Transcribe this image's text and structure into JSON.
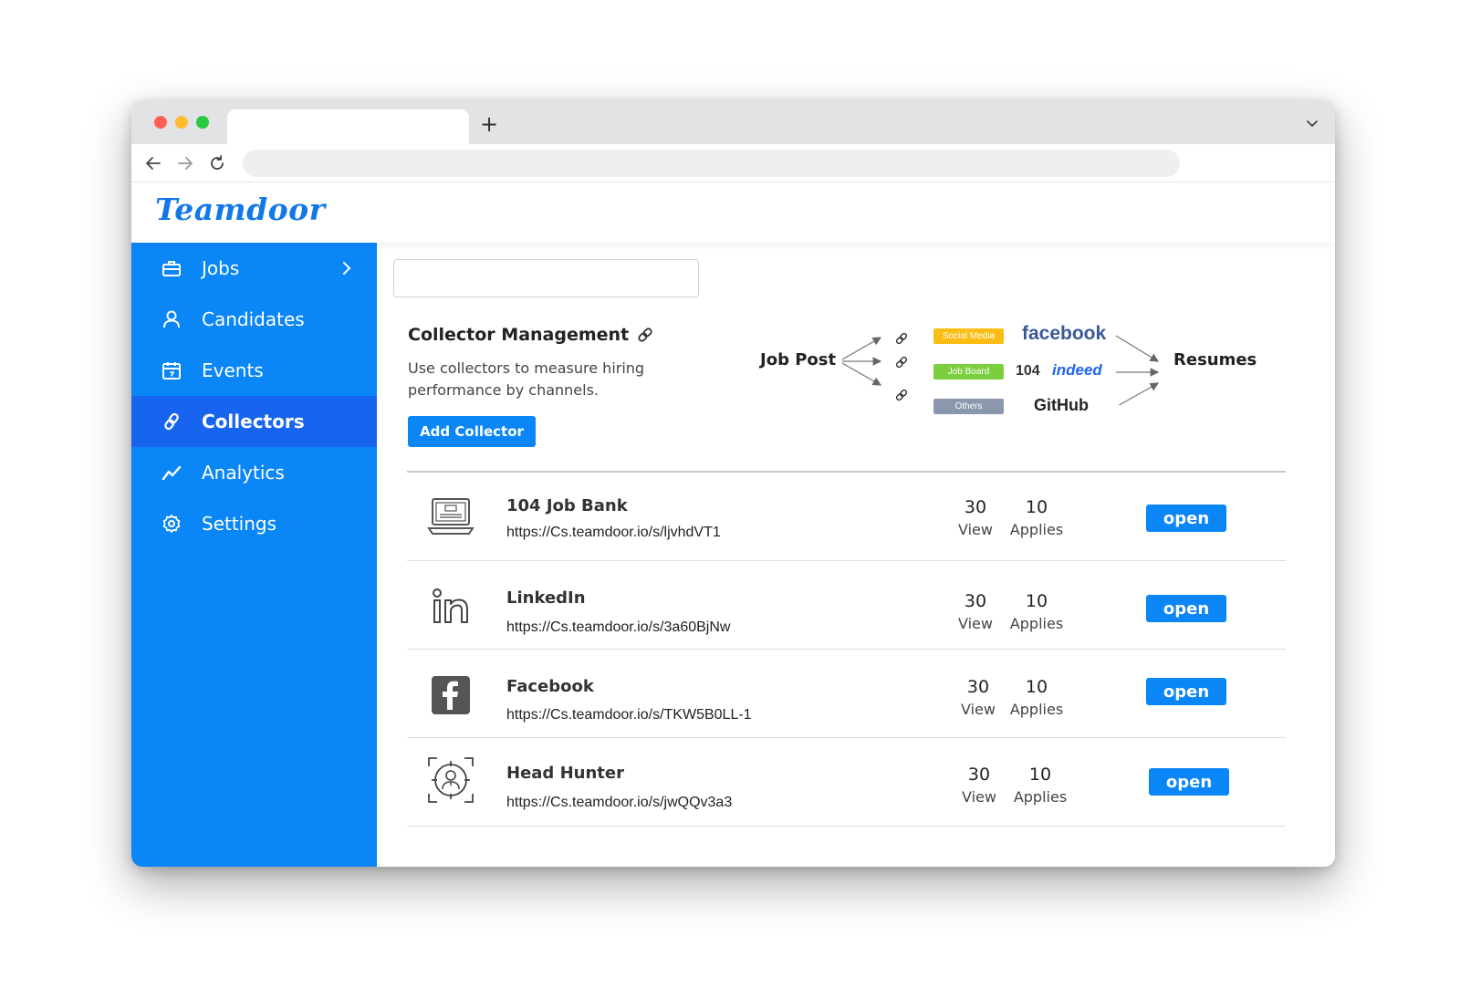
{
  "browser": {
    "new_tab": "+"
  },
  "app": {
    "logo": "Teamdoor"
  },
  "sidebar": {
    "items": [
      {
        "label": "Jobs"
      },
      {
        "label": "Candidates"
      },
      {
        "label": "Events"
      },
      {
        "label": "Collectors"
      },
      {
        "label": "Analytics"
      },
      {
        "label": "Settings"
      }
    ]
  },
  "main": {
    "search": {
      "value": "",
      "placeholder": ""
    },
    "title": "Collector Management",
    "description": "Use collectors to measure hiring performance by channels.",
    "add_button": "Add Collector",
    "diagram": {
      "source": "Job Post",
      "target": "Resumes",
      "channels": [
        "Social Media",
        "Job Board",
        "Others"
      ],
      "brands": {
        "facebook": "facebook",
        "job104": "104",
        "indeed": "indeed",
        "github": "GitHub"
      }
    },
    "collectors": [
      {
        "name": "104 Job Bank",
        "url": "https://Cs.teamdoor.io/s/ljvhdVT1",
        "views": "30",
        "applies": "10",
        "view_label": "View",
        "applies_label": "Applies",
        "button": "open",
        "icon": "laptop-job-icon"
      },
      {
        "name": "LinkedIn",
        "url": "https://Cs.teamdoor.io/s/3a60BjNw",
        "views": "30",
        "applies": "10",
        "view_label": "View",
        "applies_label": "Applies",
        "button": "open",
        "icon": "linkedin-icon"
      },
      {
        "name": "Facebook",
        "url": "https://Cs.teamdoor.io/s/TKW5B0LL-1",
        "views": "30",
        "applies": "10",
        "view_label": "View",
        "applies_label": "Applies",
        "button": "open",
        "icon": "facebook-icon"
      },
      {
        "name": "Head Hunter",
        "url": "https://Cs.teamdoor.io/s/jwQQv3a3",
        "views": "30",
        "applies": "10",
        "view_label": "View",
        "applies_label": "Applies",
        "button": "open",
        "icon": "head-hunter-icon"
      }
    ]
  },
  "colors": {
    "sidebar": "#0a86f6",
    "sidebar_active": "#1765ee",
    "accent": "#0a86f6",
    "chip_social": "#fbbd14",
    "chip_jobboard": "#7bcf3e",
    "chip_others": "#8a97ad"
  }
}
